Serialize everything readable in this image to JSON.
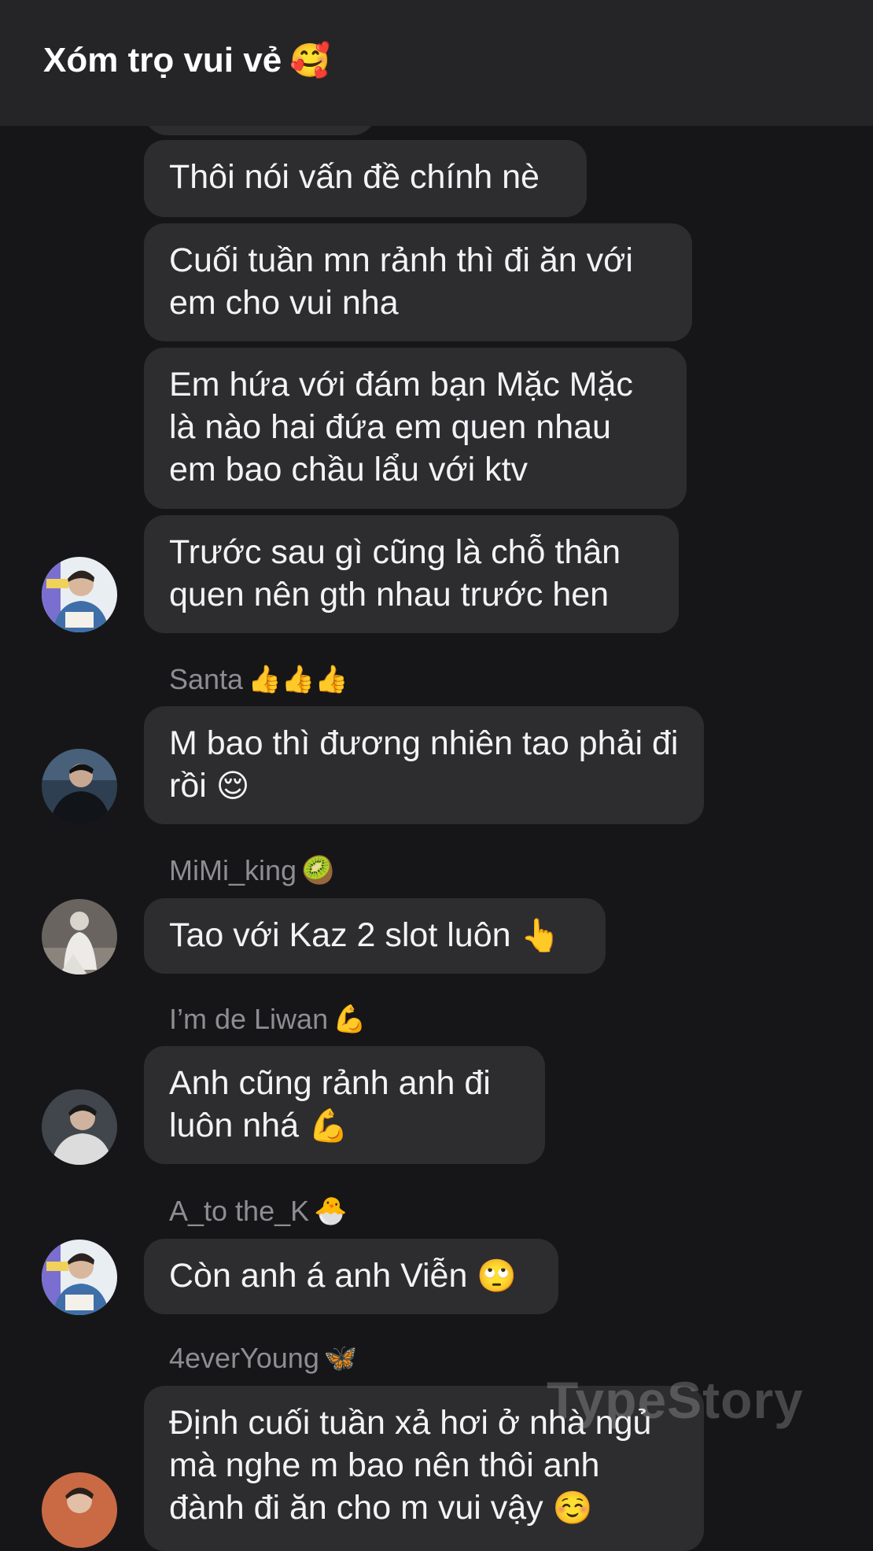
{
  "header": {
    "title": "Xóm trọ vui vẻ",
    "title_emoji": "🥰"
  },
  "messages": [
    {
      "text": "Thôi nói vấn đề chính nè"
    },
    {
      "text": "Cuối tuần mn rảnh thì đi ăn với em cho vui nha"
    },
    {
      "text": "Em hứa với đám bạn Mặc Mặc là nào hai đứa em quen nhau em bao chầu lẩu với ktv"
    },
    {
      "text": "Trước sau gì cũng là chỗ thân quen nên gth nhau trước hen"
    },
    {
      "sender": "Santa",
      "sender_emoji": "👍👍👍",
      "text": "M bao thì đương nhiên tao phải đi rồi",
      "text_emoji": "😌"
    },
    {
      "sender": "MiMi_king",
      "sender_emoji": "🥝",
      "text": "Tao với Kaz 2 slot luôn",
      "text_emoji": "👆"
    },
    {
      "sender": "I’m de Liwan",
      "sender_emoji": "💪",
      "text": "Anh cũng rảnh anh đi luôn nhá",
      "text_emoji": "💪"
    },
    {
      "sender": "A_to the_K",
      "sender_emoji": "🐣",
      "text": "Còn anh á anh Viễn",
      "text_emoji": "🙄"
    },
    {
      "sender": "4everYoung",
      "sender_emoji": "🦋",
      "text": "Định cuối tuần xả hơi ở nhà ngủ mà nghe m bao nên thôi anh đành đi ăn cho m vui vậy",
      "text_emoji": "☺️"
    }
  ],
  "watermark": "TypeStory"
}
